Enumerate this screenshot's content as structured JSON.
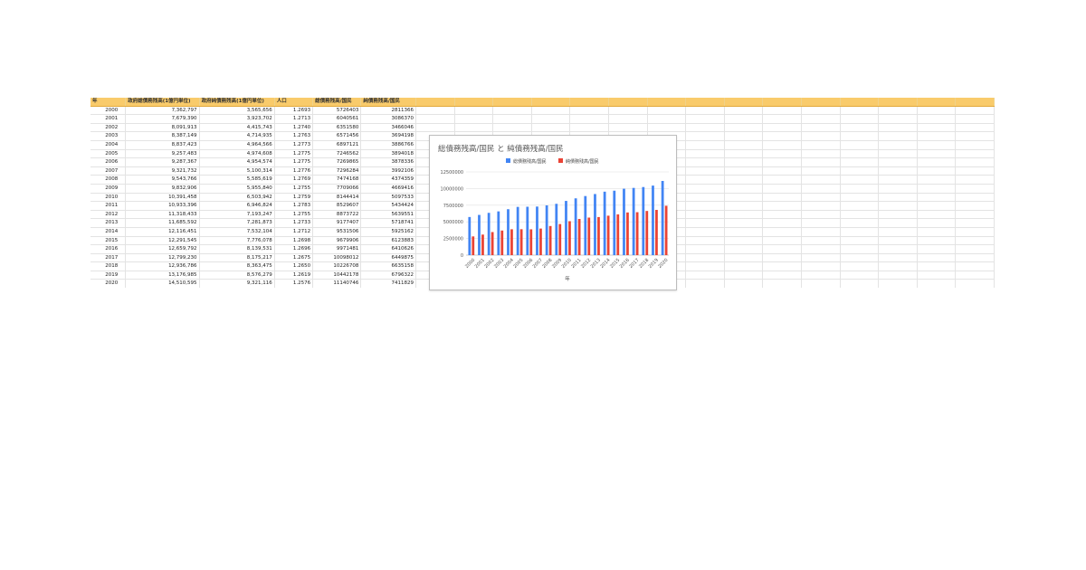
{
  "sheet": {
    "headers": [
      "年",
      "政府総債務残高(1億円単位)",
      "政府純債務残高(1億円単位)",
      "人口",
      "総債務残高/国民",
      "純債務残高/国民"
    ],
    "rows": [
      [
        "2000",
        "7,362,797",
        "3,565,656",
        "1.2693",
        "5726403",
        "2811366"
      ],
      [
        "2001",
        "7,679,390",
        "3,923,702",
        "1.2713",
        "6040561",
        "3086370"
      ],
      [
        "2002",
        "8,091,913",
        "4,415,743",
        "1.2740",
        "6351580",
        "3466046"
      ],
      [
        "2003",
        "8,387,149",
        "4,714,935",
        "1.2763",
        "6571456",
        "3694198"
      ],
      [
        "2004",
        "8,837,423",
        "4,964,566",
        "1.2773",
        "6897121",
        "3886766"
      ],
      [
        "2005",
        "9,257,483",
        "4,974,608",
        "1.2775",
        "7246562",
        "3894018"
      ],
      [
        "2006",
        "9,287,367",
        "4,954,574",
        "1.2775",
        "7269865",
        "3878336"
      ],
      [
        "2007",
        "9,321,732",
        "5,100,314",
        "1.2776",
        "7296284",
        "3992106"
      ],
      [
        "2008",
        "9,543,766",
        "5,585,619",
        "1.2769",
        "7474168",
        "4374359"
      ],
      [
        "2009",
        "9,832,906",
        "5,955,840",
        "1.2755",
        "7709066",
        "4669416"
      ],
      [
        "2010",
        "10,391,458",
        "6,503,942",
        "1.2759",
        "8144414",
        "5097533"
      ],
      [
        "2011",
        "10,933,396",
        "6,946,824",
        "1.2783",
        "8529607",
        "5434424"
      ],
      [
        "2012",
        "11,318,433",
        "7,193,247",
        "1.2755",
        "8873722",
        "5639551"
      ],
      [
        "2013",
        "11,685,592",
        "7,281,873",
        "1.2733",
        "9177407",
        "5718741"
      ],
      [
        "2014",
        "12,116,451",
        "7,532,104",
        "1.2712",
        "9531506",
        "5925162"
      ],
      [
        "2015",
        "12,291,545",
        "7,776,078",
        "1.2698",
        "9679906",
        "6123883"
      ],
      [
        "2016",
        "12,659,792",
        "8,139,531",
        "1.2696",
        "9971481",
        "6410626"
      ],
      [
        "2017",
        "12,799,230",
        "8,175,217",
        "1.2675",
        "10098012",
        "6449875"
      ],
      [
        "2018",
        "12,936,786",
        "8,363,475",
        "1.2650",
        "10226708",
        "6635158"
      ],
      [
        "2019",
        "13,176,985",
        "8,576,279",
        "1.2619",
        "10442178",
        "6796322"
      ],
      [
        "2020",
        "14,510,595",
        "9,321,116",
        "1.2576",
        "11140746",
        "7411829"
      ]
    ]
  },
  "chart_data": {
    "type": "bar",
    "title": "総債務残高/国民 と 純債務残高/国民",
    "xlabel": "年",
    "ylabel": "",
    "categories": [
      "2000",
      "2001",
      "2002",
      "2003",
      "2004",
      "2005",
      "2006",
      "2007",
      "2008",
      "2009",
      "2010",
      "2011",
      "2012",
      "2013",
      "2014",
      "2015",
      "2016",
      "2017",
      "2018",
      "2019",
      "2020"
    ],
    "series": [
      {
        "name": "総債務残高/国民",
        "color": "#4285f4",
        "values": [
          5726403,
          6040561,
          6351580,
          6571456,
          6897121,
          7246562,
          7269865,
          7296284,
          7474168,
          7709066,
          8144414,
          8529607,
          8873722,
          9177407,
          9531506,
          9679906,
          9971481,
          10098012,
          10226708,
          10442178,
          11140746
        ]
      },
      {
        "name": "純債務残高/国民",
        "color": "#ea4335",
        "values": [
          2811366,
          3086370,
          3466046,
          3694198,
          3886766,
          3894018,
          3878336,
          3992106,
          4374359,
          4669416,
          5097533,
          5434424,
          5639551,
          5718741,
          5925162,
          6123883,
          6410626,
          6449875,
          6635158,
          6796322,
          7411829
        ]
      }
    ],
    "yticks": [
      "0",
      "2500000",
      "5000000",
      "7500000",
      "10000000",
      "12500000"
    ],
    "ylim": [
      0,
      12500000
    ],
    "grid": true,
    "legend": "top"
  }
}
